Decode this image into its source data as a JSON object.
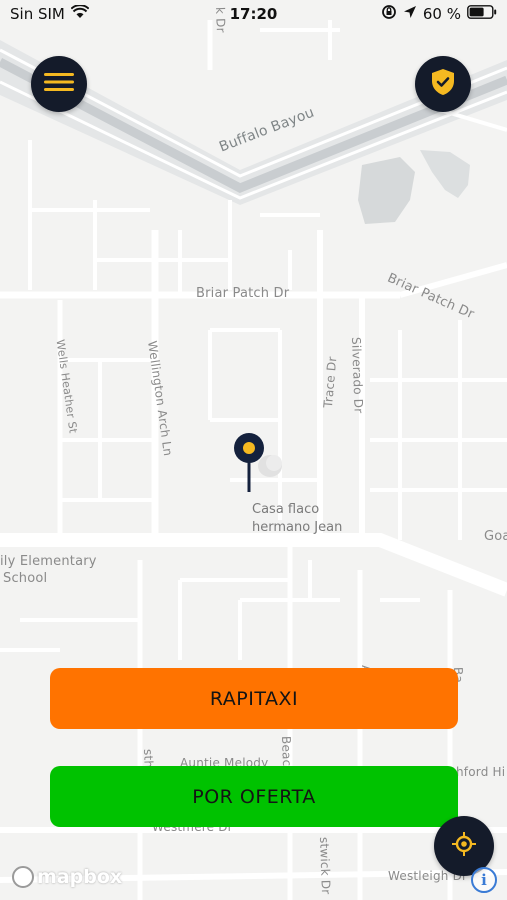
{
  "status_bar": {
    "carrier": "Sin SIM",
    "time": "17:20",
    "battery": "60 %"
  },
  "map": {
    "water_label": "Buffalo Bayou",
    "streets": [
      "Briar Patch Dr",
      "Briar Patch Dr",
      "Wells Heather St",
      "Wellington Arch Ln",
      "Trace Dr",
      "Silverado Dr",
      "ily Elementary",
      "School",
      "Goa",
      "Auntie Melody",
      "Westmere Dr",
      "Westleigh Dr",
      "hford Hi",
      "stwick Dr",
      "Beac",
      "A",
      "Ba",
      "sthurs",
      "p",
      "k Dr"
    ],
    "place": {
      "line1": "Casa flaco",
      "line2": "hermano Jean"
    },
    "attribution": "mapbox",
    "info": "i"
  },
  "buttons": {
    "rapitaxi": "RAPITAXI",
    "oferta": "POR OFERTA"
  },
  "icons": {
    "menu": "menu-icon",
    "shield": "shield-check-icon",
    "locate": "locate-icon",
    "pin": "location-pin-icon"
  },
  "colors": {
    "rapitaxi": "#ff7300",
    "oferta": "#00c200",
    "navy": "#141b2a",
    "accent": "#f5b921"
  }
}
